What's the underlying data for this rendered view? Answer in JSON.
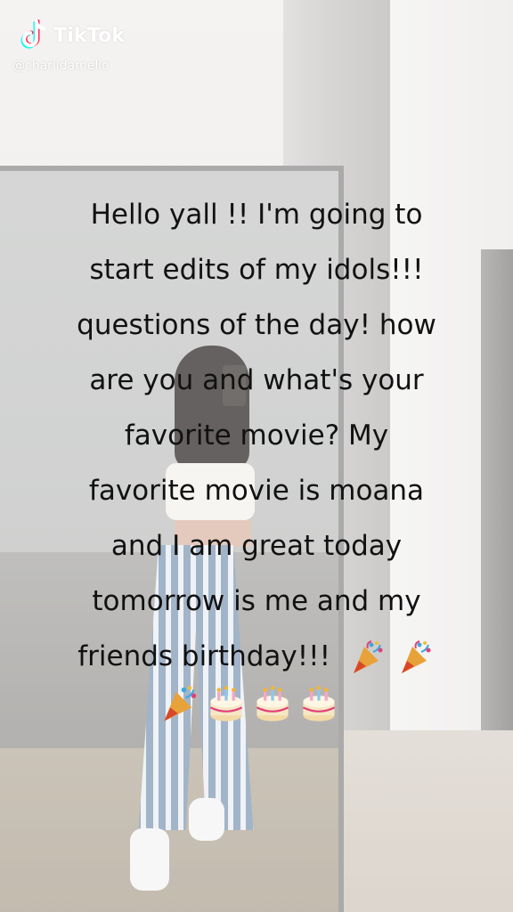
{
  "watermark": {
    "brand": "TikTok",
    "handle": "@charlidamelio",
    "logo_icon": "tiktok-note-icon"
  },
  "caption": {
    "lines": [
      "Hello yall !! I'm going to",
      "start edits of my idols!!!",
      "questions of the day! how",
      "are you and what's your",
      "favorite movie? My",
      "favorite movie is moana",
      "and I am great today",
      "tomorrow is me and my",
      "friends birthday!!!"
    ],
    "trailing_emojis": [
      "party-popper-icon",
      "party-popper-icon"
    ],
    "last_row_emojis": [
      "party-popper-icon",
      "birthday-cake-icon",
      "birthday-cake-icon",
      "birthday-cake-icon"
    ]
  }
}
